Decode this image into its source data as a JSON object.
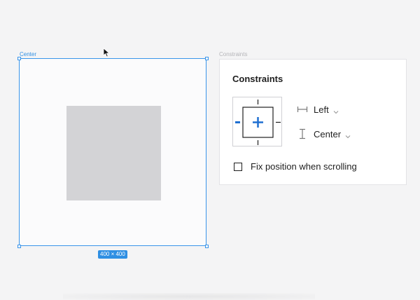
{
  "canvas": {
    "frame_label": "Center",
    "size_badge": "400 × 400"
  },
  "panel": {
    "caption": "Constraints",
    "title": "Constraints",
    "horizontal": {
      "value": "Left",
      "icon": "horizontal-constraint-icon"
    },
    "vertical": {
      "value": "Center",
      "icon": "vertical-constraint-icon"
    },
    "fix_position": {
      "label": "Fix position when scrolling",
      "checked": false
    }
  },
  "widget": {
    "active_left": true,
    "active_center_h": true,
    "active_center_v": true
  },
  "colors": {
    "accent": "#2f8fe3",
    "active": "#1f6fd1",
    "selection": "#3a95ea"
  }
}
